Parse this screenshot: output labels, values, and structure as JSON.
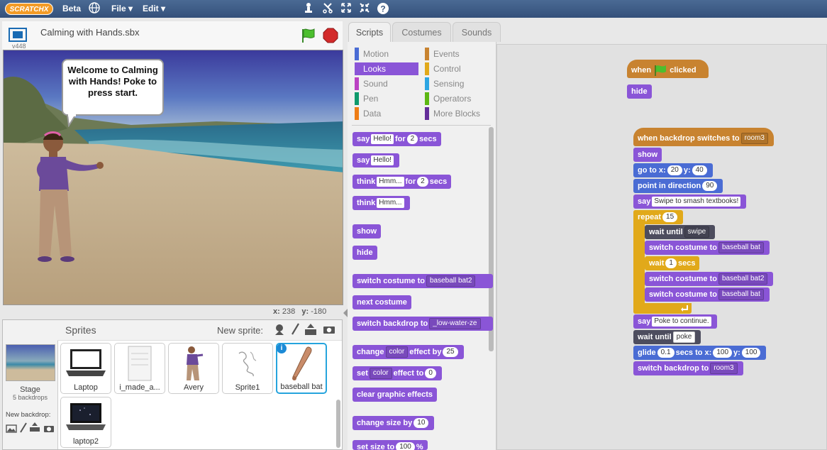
{
  "topbar": {
    "logo": "SCRATCHX",
    "beta": "Beta",
    "file_menu": "File ▾",
    "edit_menu": "Edit ▾",
    "icons": [
      "globe-icon",
      "duplicate-icon",
      "delete-icon",
      "grow-icon",
      "shrink-icon",
      "help-icon"
    ]
  },
  "stage": {
    "version": "v448",
    "project_title": "Calming with Hands.sbx",
    "speech_bubble": "Welcome to Calming with Hands! Poke to press start.",
    "x_label": "x:",
    "x_value": "238",
    "y_label": "y:",
    "y_value": "-180"
  },
  "sprites": {
    "header": "Sprites",
    "new_sprite_label": "New sprite:",
    "stage_label": "Stage",
    "stage_backdrops": "5 backdrops",
    "new_backdrop_label": "New backdrop:",
    "items": [
      {
        "name": "Laptop"
      },
      {
        "name": "i_made_a..."
      },
      {
        "name": "Avery"
      },
      {
        "name": "Sprite1"
      },
      {
        "name": "baseball bat"
      },
      {
        "name": "laptop2"
      }
    ]
  },
  "tabs": {
    "scripts": "Scripts",
    "costumes": "Costumes",
    "sounds": "Sounds"
  },
  "categories": {
    "motion": "Motion",
    "events": "Events",
    "looks": "Looks",
    "control": "Control",
    "sound": "Sound",
    "sensing": "Sensing",
    "pen": "Pen",
    "operators": "Operators",
    "data": "Data",
    "more": "More Blocks"
  },
  "palette": {
    "say": "say",
    "hello": "Hello!",
    "for": "for",
    "secs": "secs",
    "two": "2",
    "think": "think",
    "hmm": "Hmm...",
    "show": "show",
    "hide": "hide",
    "switch_costume_to": "switch costume to",
    "costume_val": "baseball bat2",
    "next_costume": "next costume",
    "switch_backdrop_to": "switch backdrop to",
    "backdrop_val": "_low-water-ze",
    "change": "change",
    "color": "color",
    "effect_by": "effect by",
    "twentyfive": "25",
    "set": "set",
    "effect_to": "effect to",
    "zero": "0",
    "clear_effects": "clear graphic effects",
    "change_size_by": "change size by",
    "ten": "10",
    "set_size": "set size to",
    "hundred": "100",
    "pct": "%"
  },
  "script1": {
    "when": "when",
    "clicked": "clicked",
    "hide": "hide"
  },
  "script2": {
    "hat": "when backdrop switches to",
    "hat_val": "room3",
    "show": "show",
    "goto_x": "go to x:",
    "goto_xv": "20",
    "goto_y": "y:",
    "goto_yv": "40",
    "point": "point in direction",
    "point_v": "90",
    "say": "say",
    "say_v": "Swipe to smash textbooks!",
    "repeat": "repeat",
    "repeat_v": "15",
    "wait_until": "wait until",
    "swipe": "swipe",
    "switch_costume": "switch costume to",
    "costume1": "baseball bat",
    "wait": "wait",
    "wait_v": "1",
    "secs": "secs",
    "costume2": "baseball bat2",
    "costume3": "baseball bat",
    "say2_v": "Poke to continue.",
    "poke": "poke",
    "glide": "glide",
    "glide_v": "0.1",
    "glide_secs": "secs to x:",
    "glide_x": "100",
    "glide_y_lbl": "y:",
    "glide_y": "100",
    "switch_backdrop": "switch backdrop to",
    "backdrop_v": "room3"
  },
  "colors": {
    "looks": "#8a55d7",
    "events": "#c88330",
    "motion": "#4a6cd4",
    "control": "#e1a91a",
    "sensing": "#2ca5e2"
  }
}
